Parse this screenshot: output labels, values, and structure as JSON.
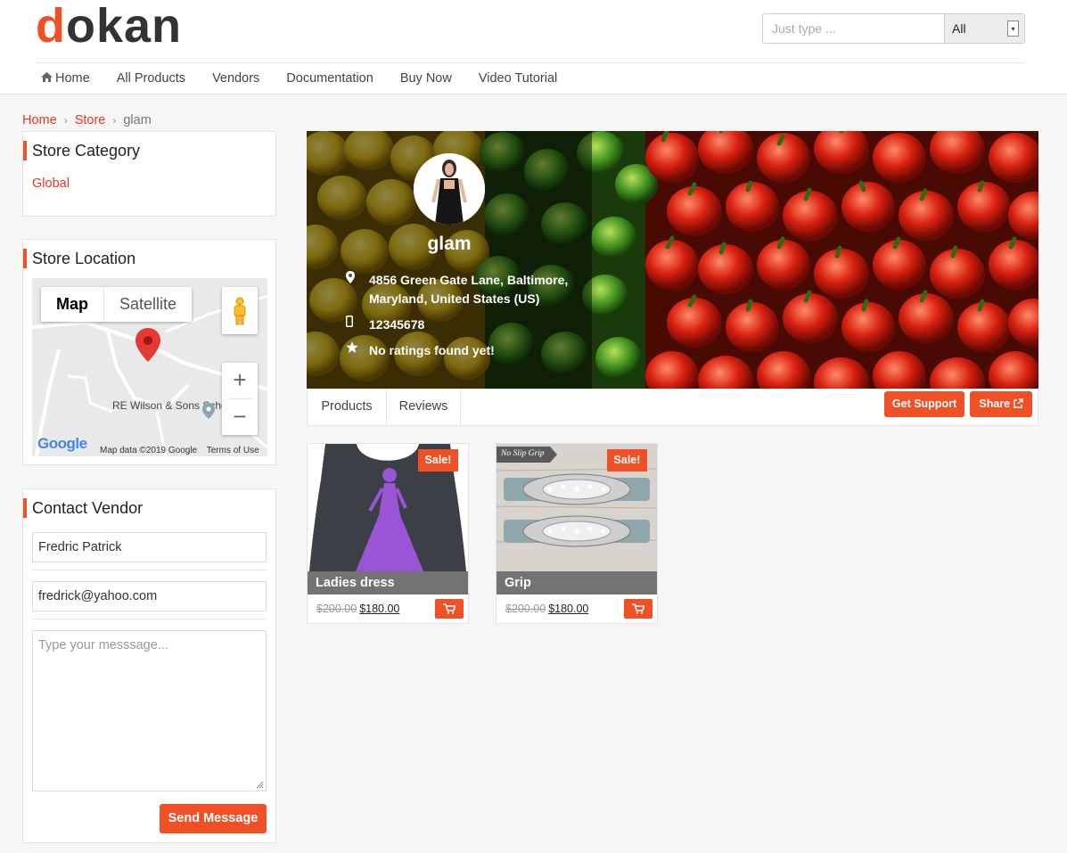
{
  "brand": {
    "logo_first": "d",
    "logo_rest": "okan",
    "accent": "#f05025"
  },
  "search": {
    "placeholder": "Just type ...",
    "category": "All"
  },
  "nav": {
    "items": [
      "Home",
      "All Products",
      "Vendors",
      "Documentation",
      "Buy Now",
      "Video Tutorial"
    ]
  },
  "breadcrumb": {
    "home": "Home",
    "store": "Store",
    "current": "glam"
  },
  "store_category": {
    "title": "Store Category",
    "link": "Global"
  },
  "store_location": {
    "title": "Store Location",
    "map_tab": "Map",
    "satellite_tab": "Satellite",
    "zoom_in": "+",
    "zoom_out": "−",
    "place_label": "RE Wilson & Sons School Bus",
    "google": "Google",
    "map_data": "Map data ©2019 Google",
    "terms": "Terms of Use"
  },
  "contact": {
    "title": "Contact Vendor",
    "name_value": "Fredric Patrick",
    "email_value": "fredrick@yahoo.com",
    "message_placeholder": "Type your messsage...",
    "send_label": "Send Message"
  },
  "store": {
    "name": "glam",
    "address": "4856 Green Gate Lane, Baltimore, Maryland, United States (US)",
    "phone": "12345678",
    "rating": "No ratings found yet!"
  },
  "tabs": {
    "products": "Products",
    "reviews": "Reviews",
    "support": "Get Support",
    "share": "Share"
  },
  "products": [
    {
      "name": "Ladies dress",
      "old_price": "$200.00",
      "new_price": "$180.00",
      "badge": "Sale!"
    },
    {
      "name": "Grip",
      "old_price": "$200.00",
      "new_price": "$180.00",
      "badge": "Sale!",
      "image_text": "No Slip Grip"
    }
  ]
}
